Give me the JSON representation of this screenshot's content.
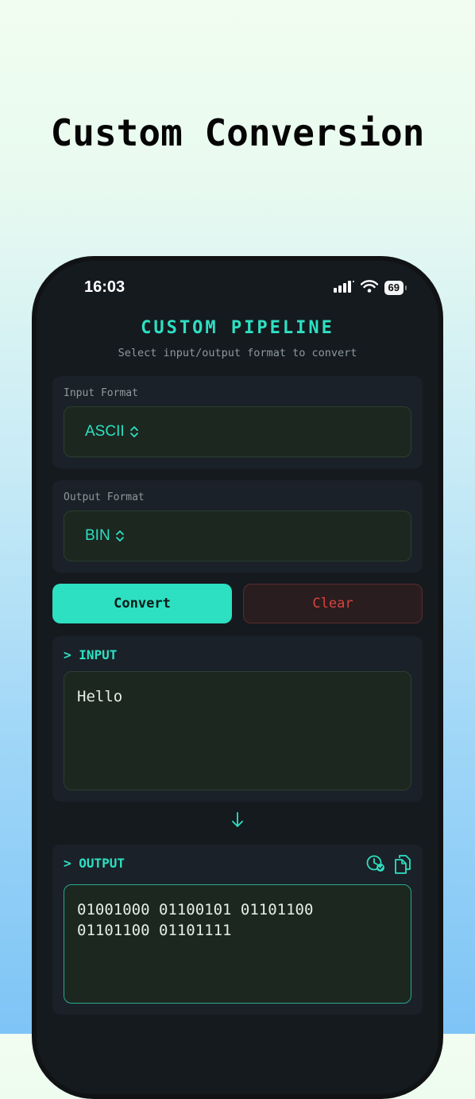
{
  "headline": "Custom Conversion",
  "status_bar": {
    "time": "16:03",
    "battery": "69"
  },
  "app": {
    "title": "CUSTOM PIPELINE",
    "subtitle": "Select input/output format to convert"
  },
  "input_format": {
    "label": "Input Format",
    "value": "ASCII"
  },
  "output_format": {
    "label": "Output Format",
    "value": "BIN"
  },
  "buttons": {
    "convert": "Convert",
    "clear": "Clear"
  },
  "input_section": {
    "label": "> INPUT",
    "text": "Hello"
  },
  "output_section": {
    "label": "> OUTPUT",
    "text": "01001000 01100101 01101100\n01101100 01101111"
  },
  "colors": {
    "accent": "#2de0c2",
    "danger": "#d9433f",
    "card_bg": "#1b2128",
    "field_bg": "#1b271f"
  },
  "icons": {
    "format_chevron": "chevron-updown-icon",
    "flow_arrow": "arrow-down-icon",
    "history": "history-icon",
    "copy": "copy-icon"
  }
}
